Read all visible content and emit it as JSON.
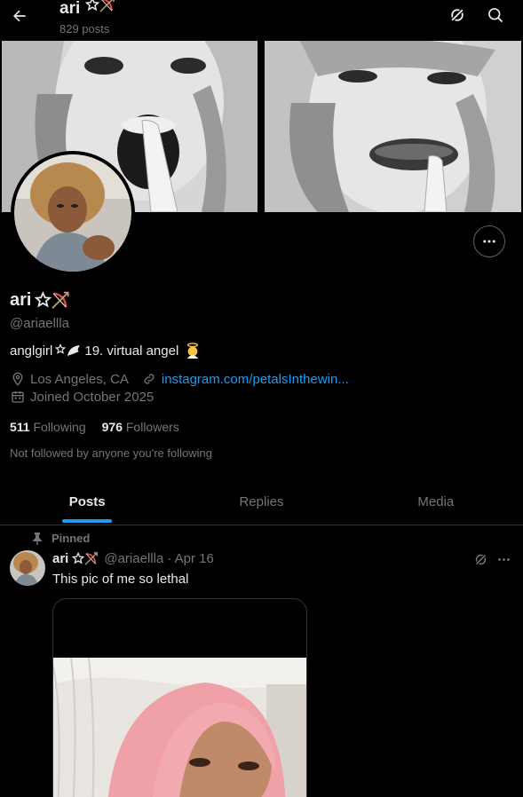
{
  "header": {
    "name": "ari",
    "post_count": "829 posts",
    "icons": [
      "back-arrow-icon",
      "grok-icon",
      "search-icon"
    ]
  },
  "profile": {
    "display_name": "ari",
    "handle": "@ariaellla",
    "bio_prefix": "anglgirl",
    "bio_suffix": "19. virtual angel",
    "location": "Los Angeles, CA",
    "website": "instagram.com/petalsInthewin...",
    "joined": "Joined October 2025",
    "following_count": "511",
    "following_label": "Following",
    "followers_count": "976",
    "followers_label": "Followers",
    "not_followed": "Not followed by anyone you're following"
  },
  "tabs": [
    {
      "label": "Posts",
      "active": true
    },
    {
      "label": "Replies",
      "active": false
    },
    {
      "label": "Media",
      "active": false
    }
  ],
  "post": {
    "pinned_label": "Pinned",
    "author": "ari",
    "handle": "@ariaellla",
    "date": "· Apr 16",
    "text": "This pic of me so lethal"
  },
  "colors": {
    "accent": "#1d9bf0",
    "muted": "#71767b",
    "text": "#e7e9ea",
    "border": "#2f3336"
  }
}
